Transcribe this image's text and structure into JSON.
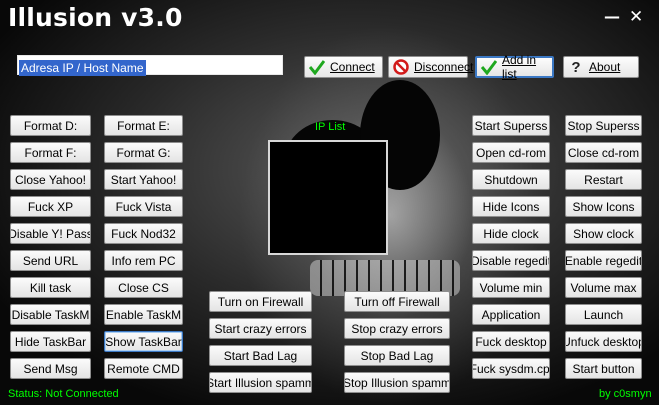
{
  "window": {
    "title": "Illusion v3.0",
    "minimize": "—",
    "close": "✕"
  },
  "host_field": {
    "value": "Adresa IP / Host Name"
  },
  "toolbar": {
    "connect": "Connect",
    "disconnect": "Disconnect",
    "add_in_list": "Add in list",
    "about": "About"
  },
  "ip_list": {
    "label": "IP List"
  },
  "left_col1": [
    "Format D:",
    "Format F:",
    "Close Yahoo!",
    "Fuck XP",
    "Disable Y! Pass",
    "Send URL",
    "Kill task",
    "Disable TaskM",
    "Hide TaskBar",
    "Send Msg"
  ],
  "left_col2": [
    "Format E:",
    "Format G:",
    "Start Yahoo!",
    "Fuck Vista",
    "Fuck Nod32",
    "Info rem PC",
    "Close CS",
    "Enable TaskM",
    "Show TaskBar",
    "Remote CMD"
  ],
  "center_left": [
    "Turn on Firewall",
    "Start crazy errors",
    "Start Bad Lag",
    "Start Illusion spamm"
  ],
  "center_right": [
    "Turn off Firewall",
    "Stop crazy errors",
    "Stop Bad Lag",
    "Stop Illusion spamm"
  ],
  "right_col1": [
    "Start Superss",
    "Open cd-rom",
    "Shutdown",
    "Hide Icons",
    "Hide clock",
    "Disable regedit",
    "Volume min",
    "Application",
    "Fuck desktop",
    "Fuck sysdm.cpl"
  ],
  "right_col2": [
    "Stop Superss",
    "Close cd-rom",
    "Restart",
    "Show Icons",
    "Show clock",
    "Enable regedit",
    "Volume max",
    "Launch",
    "Unfuck desktop",
    "Start button"
  ],
  "status": {
    "text": "Status: Not Connected",
    "author": "by c0smyn"
  },
  "colors": {
    "status_green": "#00ff00",
    "focus_blue": "#3b78c4"
  }
}
